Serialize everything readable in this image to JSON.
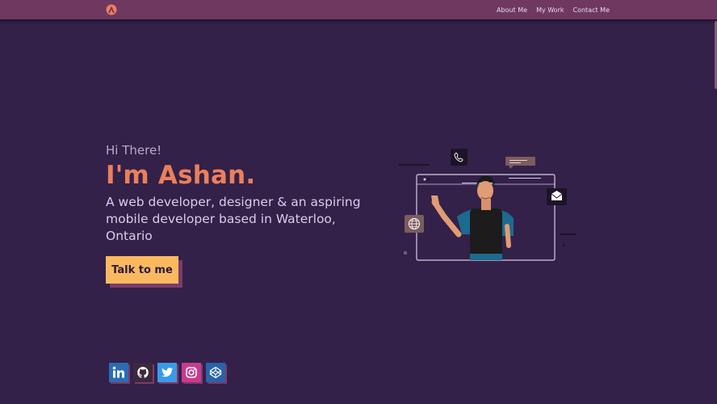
{
  "nav": {
    "logo_icon": "triangle-a-logo-icon",
    "links": [
      {
        "label": "About Me"
      },
      {
        "label": "My Work"
      },
      {
        "label": "Contact Me"
      }
    ]
  },
  "hero": {
    "greeting": "Hi There!",
    "name": "I'm Ashan.",
    "tagline": "A web developer, designer & an aspiring mobile developer based in Waterloo, Ontario",
    "cta_label": "Talk to me"
  },
  "illustration": {
    "icons": [
      "phone-icon",
      "chat-bubble-icon",
      "mail-icon",
      "globe-icon"
    ]
  },
  "socials": [
    {
      "icon": "linkedin-icon",
      "color": "#2a6db3"
    },
    {
      "icon": "github-icon",
      "color": "#3a2a3c"
    },
    {
      "icon": "twitter-icon",
      "color": "#3b9ae6"
    },
    {
      "icon": "instagram-icon",
      "color": "#c93a8e"
    },
    {
      "icon": "codepen-icon",
      "color": "#2b62a8"
    }
  ],
  "colors": {
    "background": "#33214a",
    "navbar": "#6f3860",
    "accent": "#ec7f5b",
    "button": "#fbb95f",
    "shadow": "#7b3b69"
  }
}
